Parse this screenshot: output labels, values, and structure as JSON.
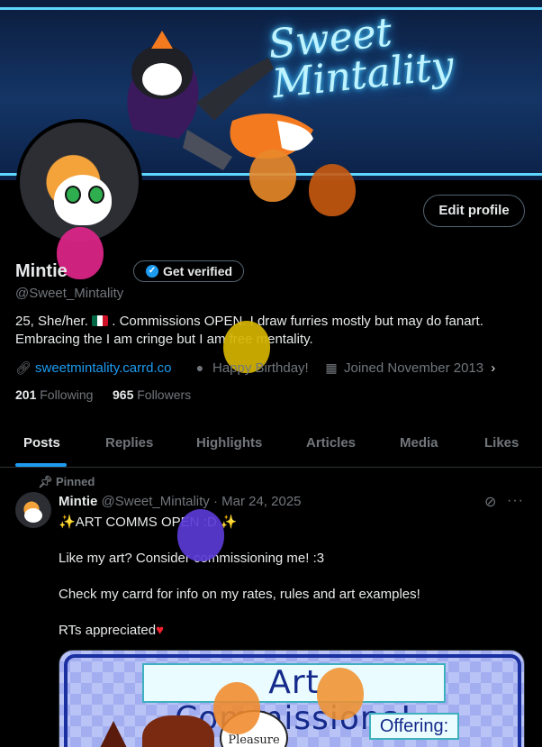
{
  "banner": {
    "title": "Sweet Mintality"
  },
  "profile": {
    "edit_profile_label": "Edit profile",
    "name": "Mintie",
    "get_verified_label": "Get verified",
    "handle": "@Sweet_Mintality",
    "bio_before_flag": "25, She/her.",
    "bio_after_flag": ". Commissions OPEN. I draw furries mostly but may do fanart. Embracing the I am cringe but I am free mentality.",
    "link": "sweetmintality.carrd.co",
    "birthday": "Happy Birthday!",
    "joined": "Joined November 2013",
    "following_count": "201",
    "following_label": "Following",
    "followers_count": "965",
    "followers_label": "Followers"
  },
  "tabs": [
    {
      "label": "Posts",
      "active": true
    },
    {
      "label": "Replies",
      "active": false
    },
    {
      "label": "Highlights",
      "active": false
    },
    {
      "label": "Articles",
      "active": false
    },
    {
      "label": "Media",
      "active": false
    },
    {
      "label": "Likes",
      "active": false
    }
  ],
  "post": {
    "pinned_label": "Pinned",
    "author": "Mintie",
    "handle_date": "@Sweet_Mintality · Mar 24, 2025",
    "line1": "ART COMMS OPEN :D",
    "line2": "Like my art? Consider commissioning me! :3",
    "line3": "Check my carrd for info on my rates, rules and art examples!",
    "line4": "RTs appreciated",
    "media": {
      "title": "Art Commissions!",
      "offering": "Offering:",
      "speech": "Pleasure"
    }
  },
  "icons": {
    "verified": "verified-check-icon",
    "link": "link-icon",
    "balloon": "balloon-icon",
    "calendar": "calendar-icon",
    "pin": "pin-icon",
    "grok": "grok-icon",
    "more": "more-icon"
  },
  "colors": {
    "accent": "#1d9bf0",
    "background": "#000000",
    "text": "#e7e9ea",
    "muted": "#71767b",
    "heart": "#f4212e"
  }
}
